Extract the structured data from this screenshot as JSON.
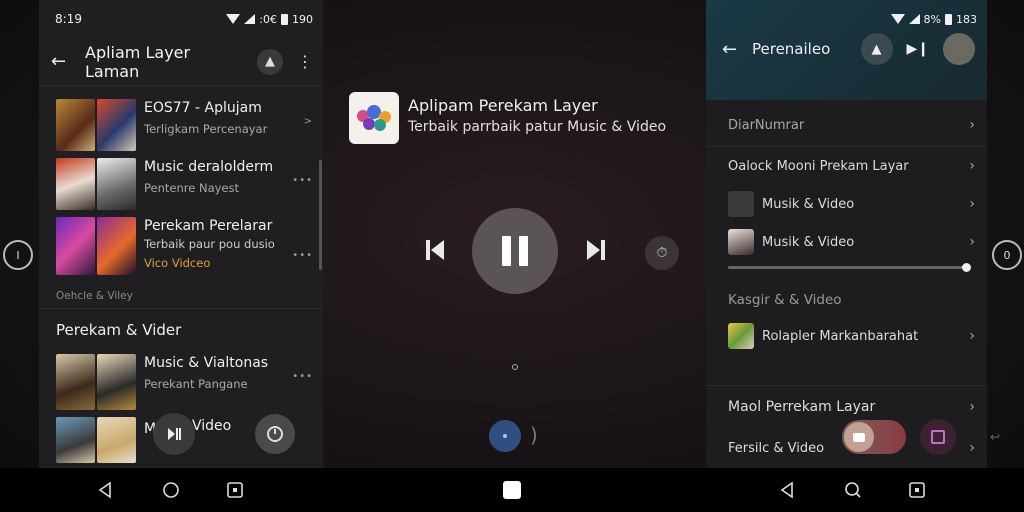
{
  "left": {
    "status": {
      "time": "8:19",
      "battery_text": "190",
      "extra_text": ":0€"
    },
    "appbar": {
      "title": "Apliam Layer Laman"
    },
    "items": [
      {
        "title": "EOS77 - Aplujam",
        "subtitle": "Terligkam Percenayar",
        "meta": ">"
      },
      {
        "title": "Music deralolderm",
        "subtitle": "Pentenre Nayest",
        "meta": "•••"
      },
      {
        "title": "Perekam Perelarar",
        "subtitle": "Terbaik paur pou dusio",
        "subtitle2": "Vico Vidceo",
        "meta": "•••"
      }
    ],
    "caption": "Oehcle & Viley",
    "section_header": "Perekam & Vider",
    "items2": [
      {
        "title": "Music & Vialtonas",
        "subtitle": "Perekant Pangane",
        "meta": "•••"
      },
      {
        "title": "M",
        "title_end": "Video"
      }
    ]
  },
  "center": {
    "now_playing_title": "Aplipam Perekam Layer",
    "now_playing_subtitle": "Terbaik parrbaik patur Music & Video"
  },
  "right": {
    "status": {
      "battery_text": "8%",
      "time": "183"
    },
    "appbar": {
      "title": "Perenaileo"
    },
    "row_top": "DiarNumrar",
    "row_header": "Oalock Mooni Prekam Layar",
    "sub_rows": [
      "Musik & Video",
      "Musik & Video"
    ],
    "section_label": "Kasgir & & Video",
    "row_item": "Rolapler Markanbarahat",
    "bottom_rows": [
      "Maol Perrekam Layar",
      "Fersilc & Video"
    ]
  },
  "colors": {
    "accent_orange": "#e0a22a",
    "right_header": "#1b3a45",
    "toggle": "#8b3a44",
    "blue_dot": "#2f4f7f"
  }
}
